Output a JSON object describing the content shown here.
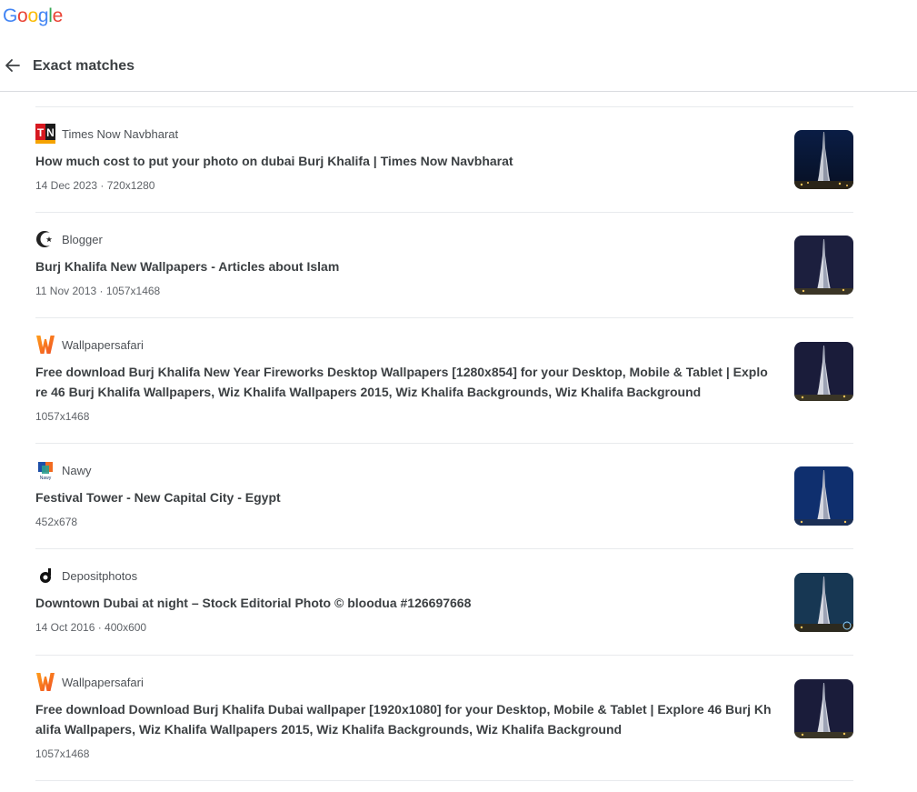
{
  "logo": {
    "letters": [
      "G",
      "o",
      "o",
      "g",
      "l",
      "e"
    ],
    "colors": [
      "#4285F4",
      "#EA4335",
      "#FBBC05",
      "#4285F4",
      "#34A853",
      "#EA4335"
    ]
  },
  "header": {
    "title": "Exact matches"
  },
  "results": [
    {
      "source": "Times Now Navbharat",
      "favicon": "tn-logo-icon",
      "title": "How much cost to put your photo on dubai Burj Khalifa | Times Now Navbharat",
      "meta": "14 Dec 2023 · 720x1280"
    },
    {
      "source": "Blogger",
      "favicon": "crescent-star-icon",
      "title": "Burj Khalifa New Wallpapers - Articles about Islam",
      "meta": "11 Nov 2013 · 1057x1468"
    },
    {
      "source": "Wallpapersafari",
      "favicon": "wallpapersafari-w-icon",
      "title": "Free download Burj Khalifa New Year Fireworks Desktop Wallpapers [1280x854] for your Desktop, Mobile & Tablet | Explore 46 Burj Khalifa Wallpapers, Wiz Khalifa Wallpapers 2015, Wiz Khalifa Backgrounds, Wiz Khalifa Background",
      "meta": "1057x1468"
    },
    {
      "source": "Nawy",
      "favicon": "nawy-logo-icon",
      "title": "Festival Tower - New Capital City - Egypt",
      "meta": "452x678"
    },
    {
      "source": "Depositphotos",
      "favicon": "depositphotos-logo-icon",
      "title": "Downtown Dubai at night – Stock Editorial Photo © bloodua #126697668",
      "meta": "14 Oct 2016 · 400x600"
    },
    {
      "source": "Wallpapersafari",
      "favicon": "wallpapersafari-w-icon",
      "title": "Free download Download Burj Khalifa Dubai wallpaper [1920x1080] for your Desktop, Mobile & Tablet | Explore 46 Burj Khalifa Wallpapers, Wiz Khalifa Wallpapers 2015, Wiz Khalifa Backgrounds, Wiz Khalifa Background",
      "meta": "1057x1468"
    }
  ]
}
